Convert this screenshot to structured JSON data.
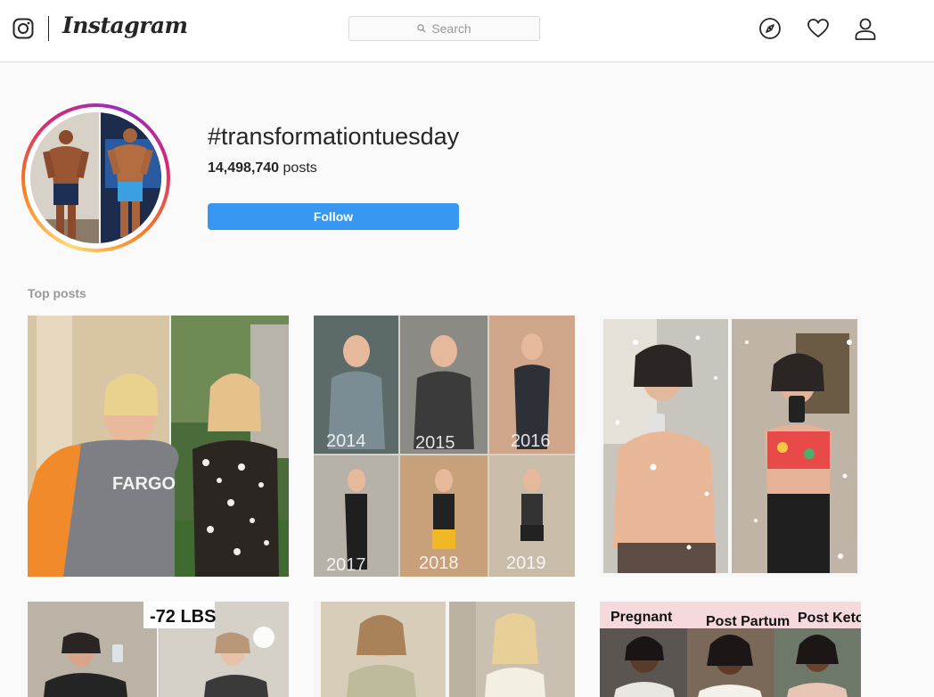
{
  "header": {
    "brand": "Instagram",
    "search_placeholder": "Search"
  },
  "icons": {
    "logo": "instagram-camera-icon",
    "search": "search-icon",
    "explore": "compass-icon",
    "activity": "heart-icon",
    "profile": "person-icon"
  },
  "profile": {
    "hashtag": "#transformationtuesday",
    "post_count": "14,498,740",
    "post_count_suffix": " posts",
    "follow_label": "Follow"
  },
  "top_posts": {
    "label": "Top posts",
    "captions": {
      "years_top": [
        "2014",
        "2015",
        "2016"
      ],
      "years_bottom": [
        "2017",
        "2018",
        "2019"
      ],
      "weight_loss": "-72 LBS",
      "stages": [
        "Pregnant",
        "Post Partum",
        "Post Keto"
      ],
      "shirt_text": "FARGO"
    }
  },
  "colors": {
    "accent_blue": "#3897f0",
    "border": "#dbdbdb",
    "background": "#fafafa"
  }
}
